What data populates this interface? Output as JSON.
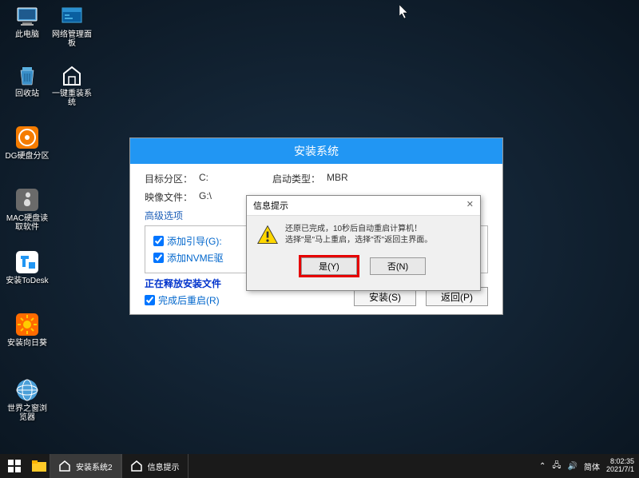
{
  "desktop": {
    "icons": [
      {
        "label": "此电脑",
        "icon": "pc"
      },
      {
        "label": "网络管理面板",
        "icon": "panel"
      },
      {
        "label": "回收站",
        "icon": "recycle"
      },
      {
        "label": "一键重装系统",
        "icon": "reinstall"
      },
      {
        "label": "DG硬盘分区",
        "icon": "dg"
      },
      {
        "label": "MAC硬盘读取软件",
        "icon": "mac"
      },
      {
        "label": "安装ToDesk",
        "icon": "todesk"
      },
      {
        "label": "安装向日葵",
        "icon": "sunflower"
      },
      {
        "label": "世界之窗浏览器",
        "icon": "browser"
      }
    ]
  },
  "installer": {
    "title": "安装系统",
    "target_label": "目标分区：",
    "target_value": "C:",
    "boot_label": "启动类型：",
    "boot_value": "MBR",
    "image_label": "映像文件：",
    "image_value": "G:\\",
    "advanced": "高级选项",
    "cb_boot": "添加引导(G):",
    "cb_nvme": "添加NVME驱",
    "status": "正在释放安装文件",
    "cb_restart": "完成后重启(R)",
    "btn_install": "安装(S)",
    "btn_back": "返回(P)"
  },
  "dialog": {
    "title": "信息提示",
    "msg_line1": "还原已完成，10秒后自动重启计算机！",
    "msg_line2": "选择\"是\"马上重启，选择\"否\"返回主界面。",
    "btn_yes": "是(Y)",
    "btn_no": "否(N)"
  },
  "taskbar": {
    "item1": "安装系统2",
    "item2": "信息提示",
    "ime": "简体",
    "time": "8:02:35",
    "date": "2021/7/1"
  }
}
